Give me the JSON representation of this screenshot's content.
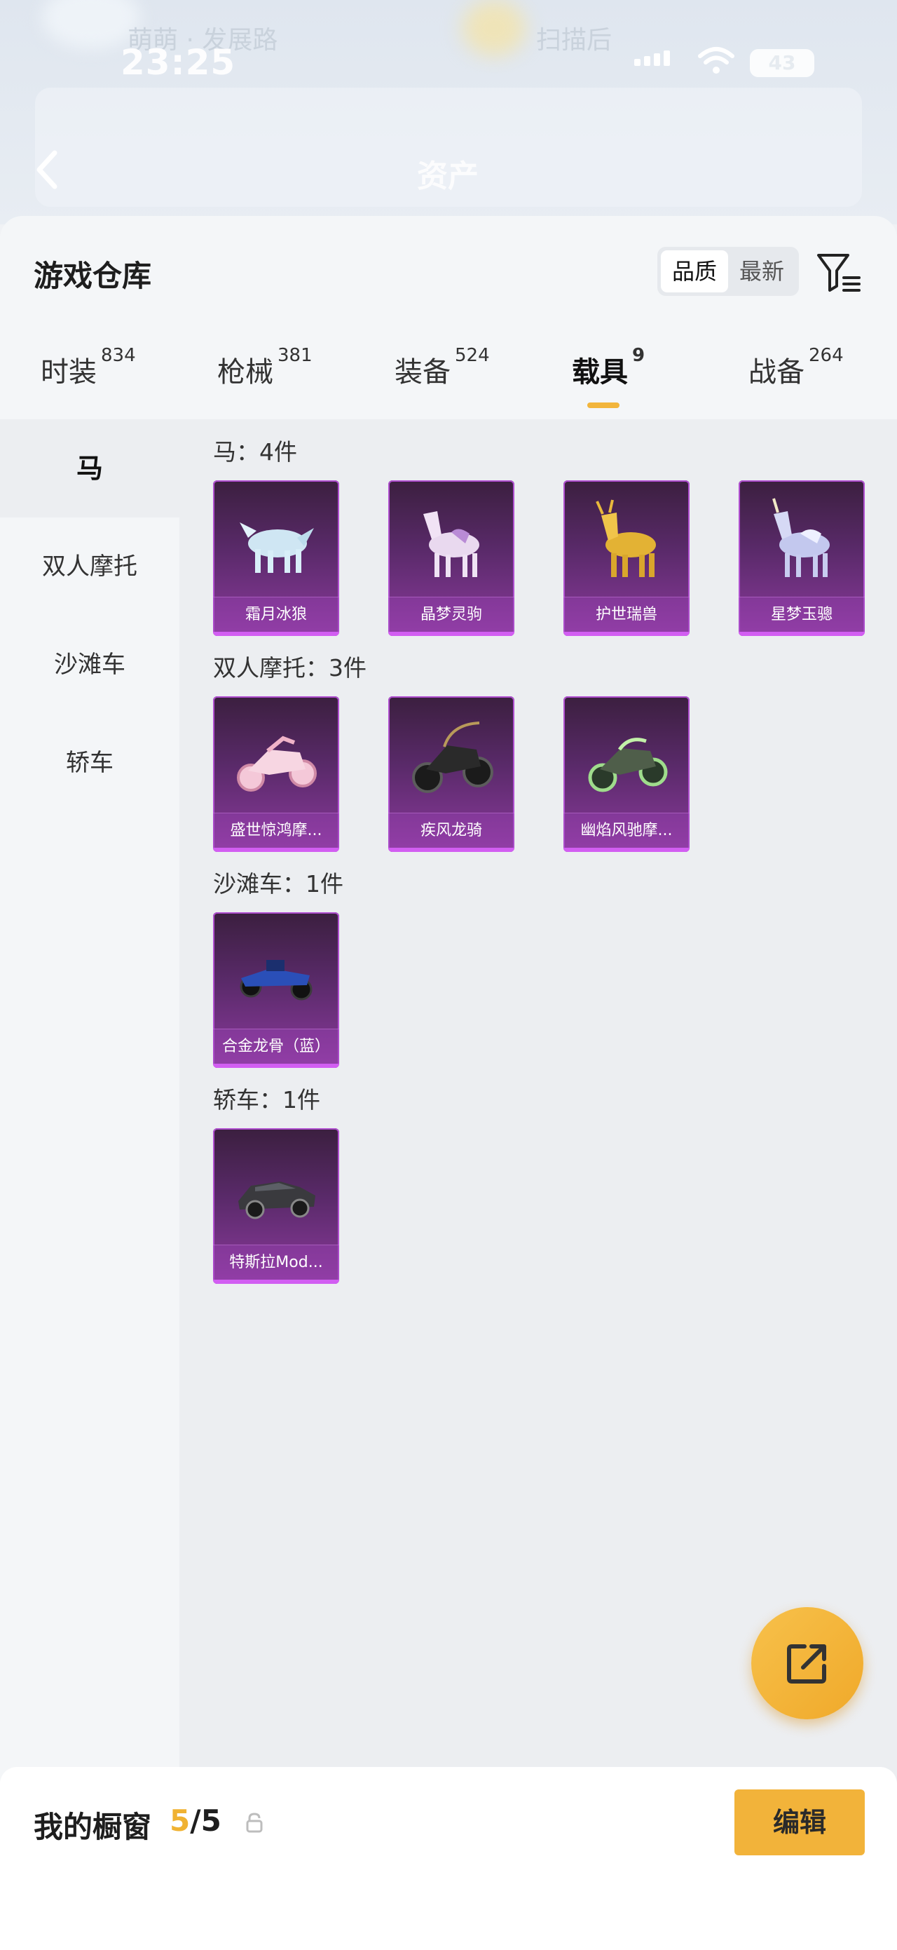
{
  "status_bar": {
    "time": "23:25",
    "battery": "43"
  },
  "header": {
    "title": "资产",
    "faint_left": "萌萌 · 发展路",
    "faint_right": "扫描后"
  },
  "warehouse": {
    "title": "游戏仓库",
    "sort": {
      "options": [
        "品质",
        "最新"
      ],
      "active": "品质"
    }
  },
  "tabs": [
    {
      "label": "时装",
      "count": "834"
    },
    {
      "label": "枪械",
      "count": "381"
    },
    {
      "label": "装备",
      "count": "524"
    },
    {
      "label": "载具",
      "count": "9",
      "active": true
    },
    {
      "label": "战备",
      "count": "264"
    }
  ],
  "sidebar": {
    "items": [
      "马",
      "双人摩托",
      "沙滩车",
      "轿车"
    ],
    "active": "马"
  },
  "sections": [
    {
      "label": "马：4件",
      "items": [
        "霜月冰狼",
        "晶梦灵驹",
        "护世瑞兽",
        "星梦玉骢"
      ]
    },
    {
      "label": "双人摩托：3件",
      "items": [
        "盛世惊鸿摩...",
        "疾风龙骑",
        "幽焰风驰摩..."
      ]
    },
    {
      "label": "沙滩车：1件",
      "items": [
        "合金龙骨（蓝）"
      ]
    },
    {
      "label": "轿车：1件",
      "items": [
        "特斯拉Mod..."
      ]
    }
  ],
  "showcase": {
    "label": "我的橱窗",
    "current": "5",
    "total": "/5",
    "edit_label": "编辑"
  },
  "icons": {
    "back": "chevron-left-icon",
    "filter": "filter-icon",
    "share": "external-link-icon",
    "lock": "lock-icon"
  },
  "colors": {
    "accent": "#f2b33a",
    "card_purple": "#8b3a9c"
  }
}
